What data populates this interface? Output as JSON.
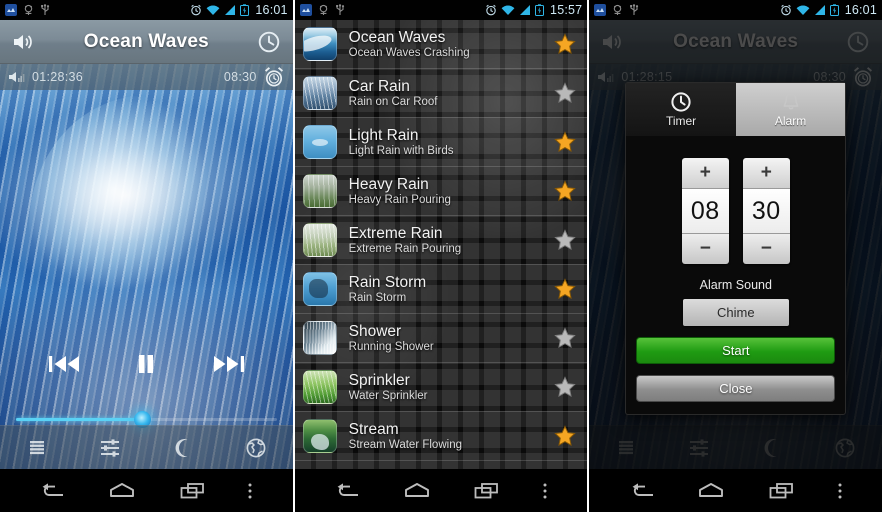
{
  "panels": {
    "player": {
      "status": {
        "clock": "16:01",
        "icons": [
          "app-icon",
          "android-debug-icon",
          "usb-icon",
          "alarm-icon",
          "wifi-icon",
          "signal-icon",
          "battery-icon"
        ]
      },
      "title": "Ocean Waves",
      "volume_icon": "speaker-icon",
      "timer_icon": "clock-icon",
      "elapsed": "01:28:36",
      "alarm_time": "08:30",
      "alarm_icon": "alarm-clock-icon",
      "transport": {
        "previous": "previous-track-icon",
        "pause": "pause-icon",
        "next": "next-track-icon"
      },
      "volume_percent": 48,
      "toolbar": [
        "list-icon",
        "equalizer-icon",
        "moon-icon",
        "globe-icon"
      ],
      "nav": [
        "back-icon",
        "home-icon",
        "recents-icon",
        "menu-icon"
      ]
    },
    "list": {
      "status": {
        "clock": "15:57"
      },
      "items": [
        {
          "title": "Ocean Waves",
          "subtitle": "Ocean Waves Crashing",
          "favorite": true,
          "thumb": "t-ocean"
        },
        {
          "title": "Car Rain",
          "subtitle": "Rain on Car Roof",
          "favorite": false,
          "thumb": "t-carrain"
        },
        {
          "title": "Light Rain",
          "subtitle": "Light Rain with Birds",
          "favorite": true,
          "thumb": "t-lightrain"
        },
        {
          "title": "Heavy Rain",
          "subtitle": "Heavy Rain Pouring",
          "favorite": true,
          "thumb": "t-heavyrain"
        },
        {
          "title": "Extreme Rain",
          "subtitle": "Extreme Rain Pouring",
          "favorite": false,
          "thumb": "t-extremerain"
        },
        {
          "title": "Rain Storm",
          "subtitle": "Rain Storm",
          "favorite": true,
          "thumb": "t-rainstorm"
        },
        {
          "title": "Shower",
          "subtitle": "Running Shower",
          "favorite": false,
          "thumb": "t-shower"
        },
        {
          "title": "Sprinkler",
          "subtitle": "Water Sprinkler",
          "favorite": false,
          "thumb": "t-sprinkler"
        },
        {
          "title": "Stream",
          "subtitle": "Stream Water Flowing",
          "favorite": true,
          "thumb": "t-stream"
        }
      ],
      "nav": [
        "back-icon",
        "home-icon",
        "recents-icon",
        "menu-icon"
      ]
    },
    "dialog_screen": {
      "status": {
        "clock": "16:01"
      },
      "title": "Ocean Waves",
      "elapsed": "01:28:15",
      "alarm_time": "08:30",
      "dialog": {
        "tabs": [
          {
            "label": "Timer",
            "icon": "clock-icon",
            "selected": true
          },
          {
            "label": "Alarm",
            "icon": "bell-icon",
            "selected": false
          }
        ],
        "hours": {
          "value": "08",
          "plus": "+",
          "minus": "−"
        },
        "minutes": {
          "value": "30",
          "plus": "+",
          "minus": "−"
        },
        "alarm_sound_label": "Alarm Sound",
        "alarm_sound_value": "Chime",
        "start_label": "Start",
        "close_label": "Close"
      },
      "nav": [
        "back-icon",
        "home-icon",
        "recents-icon",
        "menu-icon"
      ]
    }
  },
  "colors": {
    "accent": "#5ad2f5",
    "start_green": "#1f9b12",
    "star_on": "#f5a623",
    "star_off": "#b9b9b9",
    "titlebar": "#7c8b96"
  }
}
